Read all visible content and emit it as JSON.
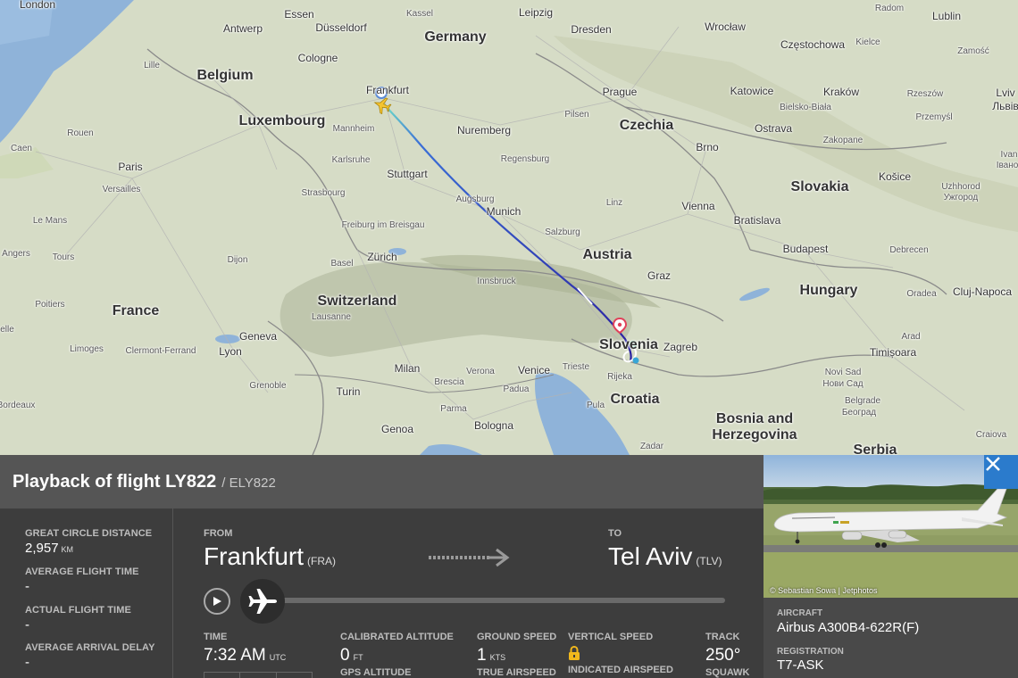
{
  "map": {
    "countries": [
      "Germany",
      "Belgium",
      "Luxembourg",
      "France",
      "Switzerland",
      "Austria",
      "Czechia",
      "Slovakia",
      "Hungary",
      "Slovenia",
      "Croatia",
      "Bosnia and Herzegovina"
    ],
    "cities": [
      "London",
      "Essen",
      "Kassel",
      "Leipzig",
      "Radom",
      "Lublin",
      "Antwerp",
      "Düsseldorf",
      "Dresden",
      "Wrocław",
      "Częstochowa",
      "Kielce",
      "Zamość",
      "Lille",
      "Cologne",
      "Frankfurt",
      "Prague",
      "Katowice",
      "Kraków",
      "Rzeszów",
      "Lviv",
      "Львів",
      "Bielsko-Biała",
      "Przemyśl",
      "Caen",
      "Rouen",
      "Mannheim",
      "Nuremberg",
      "Pilsen",
      "Ostrava",
      "Zakopane",
      "Ivan",
      "Івано",
      "Paris",
      "Versailles",
      "Karlsruhe",
      "Stuttgart",
      "Regensburg",
      "Brno",
      "Košice",
      "Uzhhorod",
      "Ужгород",
      "Strasbourg",
      "Augsburg",
      "Munich",
      "Linz",
      "Vienna",
      "Bratislava",
      "Le Mans",
      "Freiburg im Breisgau",
      "Salzburg",
      "Angers",
      "Tours",
      "Dijon",
      "Basel",
      "Zürich",
      "Budapest",
      "Debrecen",
      "Graz",
      "Innsbruck",
      "Poitiers",
      "Lausanne",
      "Oradea",
      "Cluj-Napoca",
      "Geneva",
      "Zagreb",
      "Arad",
      "Limoges",
      "Clermont-Ferrand",
      "Lyon",
      "Timișoara",
      "Milan",
      "Venice",
      "Trieste",
      "Verona",
      "Brescia",
      "Padua",
      "Rijeka",
      "Novi Sad",
      "Нови Сад",
      "Grenoble",
      "Turin",
      "Parma",
      "Pula",
      "Belgrade",
      "Београд",
      "Bordeaux",
      "Genoa",
      "Bologna",
      "Craiova",
      "Zadar",
      "Serbia",
      "elle"
    ],
    "origin_airport": "Frankfurt",
    "destination_marker": "Ljubljana"
  },
  "panel": {
    "title": "Playback of flight LY822",
    "subtitle": "/ ELY822",
    "stats": {
      "great_circle_label": "GREAT CIRCLE DISTANCE",
      "great_circle_value": "2,957",
      "great_circle_unit": "KM",
      "avg_flight_time_label": "AVERAGE FLIGHT TIME",
      "avg_flight_time_value": "-",
      "actual_flight_time_label": "ACTUAL FLIGHT TIME",
      "actual_flight_time_value": "-",
      "avg_arrival_delay_label": "AVERAGE ARRIVAL DELAY",
      "avg_arrival_delay_value": "-"
    },
    "route": {
      "from_label": "FROM",
      "from_city": "Frankfurt",
      "from_code": "(FRA)",
      "to_label": "TO",
      "to_city": "Tel Aviv",
      "to_code": "(TLV)"
    },
    "playback_progress": 0.0,
    "metrics": {
      "time_label": "TIME",
      "time_value": "7:32 AM",
      "time_unit": "UTC",
      "cal_alt_label": "CALIBRATED ALTITUDE",
      "cal_alt_value": "0",
      "cal_alt_unit": "FT",
      "gps_alt_label": "GPS ALTITUDE",
      "ground_speed_label": "GROUND SPEED",
      "ground_speed_value": "1",
      "ground_speed_unit": "KTS",
      "true_airspeed_label": "TRUE AIRSPEED",
      "vertical_speed_label": "VERTICAL SPEED",
      "vertical_speed_icon": "lock-icon",
      "indicated_airspeed_label": "INDICATED AIRSPEED",
      "track_label": "TRACK",
      "track_value": "250°",
      "squawk_label": "SQUAWK"
    }
  },
  "aircraft": {
    "photo_credit": "© Sebastian Sowa | Jetphotos",
    "aircraft_label": "AIRCRAFT",
    "aircraft_value": "Airbus A300B4-622R(F)",
    "registration_label": "REGISTRATION",
    "registration_value": "T7-ASK"
  },
  "colors": {
    "panel_bg": "#3d3d3d",
    "header_bg": "#555555",
    "close_button": "#2b7bcc",
    "track_start": "#5fd3c6",
    "track_end": "#2a2aa8"
  }
}
